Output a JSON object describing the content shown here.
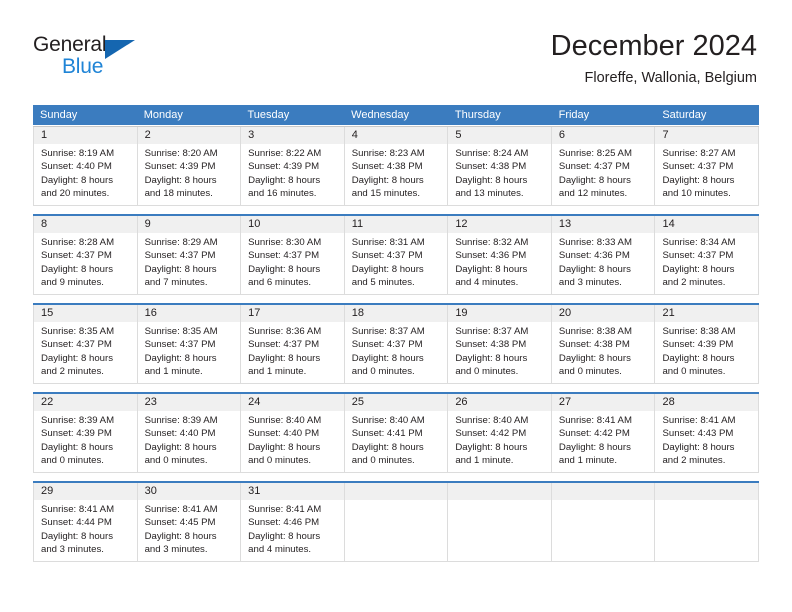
{
  "brand": {
    "name_part1": "General",
    "name_part2": "Blue",
    "accent_color": "#1f84d6",
    "triangle_color": "#1566b0"
  },
  "header": {
    "title": "December 2024",
    "subtitle": "Floreffe, Wallonia, Belgium"
  },
  "calendar": {
    "header_bg": "#3b7cbf",
    "weekdays": [
      "Sunday",
      "Monday",
      "Tuesday",
      "Wednesday",
      "Thursday",
      "Friday",
      "Saturday"
    ],
    "weeks": [
      [
        {
          "day": "1",
          "sunrise": "Sunrise: 8:19 AM",
          "sunset": "Sunset: 4:40 PM",
          "daylight_line1": "Daylight: 8 hours",
          "daylight_line2": "and 20 minutes."
        },
        {
          "day": "2",
          "sunrise": "Sunrise: 8:20 AM",
          "sunset": "Sunset: 4:39 PM",
          "daylight_line1": "Daylight: 8 hours",
          "daylight_line2": "and 18 minutes."
        },
        {
          "day": "3",
          "sunrise": "Sunrise: 8:22 AM",
          "sunset": "Sunset: 4:39 PM",
          "daylight_line1": "Daylight: 8 hours",
          "daylight_line2": "and 16 minutes."
        },
        {
          "day": "4",
          "sunrise": "Sunrise: 8:23 AM",
          "sunset": "Sunset: 4:38 PM",
          "daylight_line1": "Daylight: 8 hours",
          "daylight_line2": "and 15 minutes."
        },
        {
          "day": "5",
          "sunrise": "Sunrise: 8:24 AM",
          "sunset": "Sunset: 4:38 PM",
          "daylight_line1": "Daylight: 8 hours",
          "daylight_line2": "and 13 minutes."
        },
        {
          "day": "6",
          "sunrise": "Sunrise: 8:25 AM",
          "sunset": "Sunset: 4:37 PM",
          "daylight_line1": "Daylight: 8 hours",
          "daylight_line2": "and 12 minutes."
        },
        {
          "day": "7",
          "sunrise": "Sunrise: 8:27 AM",
          "sunset": "Sunset: 4:37 PM",
          "daylight_line1": "Daylight: 8 hours",
          "daylight_line2": "and 10 minutes."
        }
      ],
      [
        {
          "day": "8",
          "sunrise": "Sunrise: 8:28 AM",
          "sunset": "Sunset: 4:37 PM",
          "daylight_line1": "Daylight: 8 hours",
          "daylight_line2": "and 9 minutes."
        },
        {
          "day": "9",
          "sunrise": "Sunrise: 8:29 AM",
          "sunset": "Sunset: 4:37 PM",
          "daylight_line1": "Daylight: 8 hours",
          "daylight_line2": "and 7 minutes."
        },
        {
          "day": "10",
          "sunrise": "Sunrise: 8:30 AM",
          "sunset": "Sunset: 4:37 PM",
          "daylight_line1": "Daylight: 8 hours",
          "daylight_line2": "and 6 minutes."
        },
        {
          "day": "11",
          "sunrise": "Sunrise: 8:31 AM",
          "sunset": "Sunset: 4:37 PM",
          "daylight_line1": "Daylight: 8 hours",
          "daylight_line2": "and 5 minutes."
        },
        {
          "day": "12",
          "sunrise": "Sunrise: 8:32 AM",
          "sunset": "Sunset: 4:36 PM",
          "daylight_line1": "Daylight: 8 hours",
          "daylight_line2": "and 4 minutes."
        },
        {
          "day": "13",
          "sunrise": "Sunrise: 8:33 AM",
          "sunset": "Sunset: 4:36 PM",
          "daylight_line1": "Daylight: 8 hours",
          "daylight_line2": "and 3 minutes."
        },
        {
          "day": "14",
          "sunrise": "Sunrise: 8:34 AM",
          "sunset": "Sunset: 4:37 PM",
          "daylight_line1": "Daylight: 8 hours",
          "daylight_line2": "and 2 minutes."
        }
      ],
      [
        {
          "day": "15",
          "sunrise": "Sunrise: 8:35 AM",
          "sunset": "Sunset: 4:37 PM",
          "daylight_line1": "Daylight: 8 hours",
          "daylight_line2": "and 2 minutes."
        },
        {
          "day": "16",
          "sunrise": "Sunrise: 8:35 AM",
          "sunset": "Sunset: 4:37 PM",
          "daylight_line1": "Daylight: 8 hours",
          "daylight_line2": "and 1 minute."
        },
        {
          "day": "17",
          "sunrise": "Sunrise: 8:36 AM",
          "sunset": "Sunset: 4:37 PM",
          "daylight_line1": "Daylight: 8 hours",
          "daylight_line2": "and 1 minute."
        },
        {
          "day": "18",
          "sunrise": "Sunrise: 8:37 AM",
          "sunset": "Sunset: 4:37 PM",
          "daylight_line1": "Daylight: 8 hours",
          "daylight_line2": "and 0 minutes."
        },
        {
          "day": "19",
          "sunrise": "Sunrise: 8:37 AM",
          "sunset": "Sunset: 4:38 PM",
          "daylight_line1": "Daylight: 8 hours",
          "daylight_line2": "and 0 minutes."
        },
        {
          "day": "20",
          "sunrise": "Sunrise: 8:38 AM",
          "sunset": "Sunset: 4:38 PM",
          "daylight_line1": "Daylight: 8 hours",
          "daylight_line2": "and 0 minutes."
        },
        {
          "day": "21",
          "sunrise": "Sunrise: 8:38 AM",
          "sunset": "Sunset: 4:39 PM",
          "daylight_line1": "Daylight: 8 hours",
          "daylight_line2": "and 0 minutes."
        }
      ],
      [
        {
          "day": "22",
          "sunrise": "Sunrise: 8:39 AM",
          "sunset": "Sunset: 4:39 PM",
          "daylight_line1": "Daylight: 8 hours",
          "daylight_line2": "and 0 minutes."
        },
        {
          "day": "23",
          "sunrise": "Sunrise: 8:39 AM",
          "sunset": "Sunset: 4:40 PM",
          "daylight_line1": "Daylight: 8 hours",
          "daylight_line2": "and 0 minutes."
        },
        {
          "day": "24",
          "sunrise": "Sunrise: 8:40 AM",
          "sunset": "Sunset: 4:40 PM",
          "daylight_line1": "Daylight: 8 hours",
          "daylight_line2": "and 0 minutes."
        },
        {
          "day": "25",
          "sunrise": "Sunrise: 8:40 AM",
          "sunset": "Sunset: 4:41 PM",
          "daylight_line1": "Daylight: 8 hours",
          "daylight_line2": "and 0 minutes."
        },
        {
          "day": "26",
          "sunrise": "Sunrise: 8:40 AM",
          "sunset": "Sunset: 4:42 PM",
          "daylight_line1": "Daylight: 8 hours",
          "daylight_line2": "and 1 minute."
        },
        {
          "day": "27",
          "sunrise": "Sunrise: 8:41 AM",
          "sunset": "Sunset: 4:42 PM",
          "daylight_line1": "Daylight: 8 hours",
          "daylight_line2": "and 1 minute."
        },
        {
          "day": "28",
          "sunrise": "Sunrise: 8:41 AM",
          "sunset": "Sunset: 4:43 PM",
          "daylight_line1": "Daylight: 8 hours",
          "daylight_line2": "and 2 minutes."
        }
      ],
      [
        {
          "day": "29",
          "sunrise": "Sunrise: 8:41 AM",
          "sunset": "Sunset: 4:44 PM",
          "daylight_line1": "Daylight: 8 hours",
          "daylight_line2": "and 3 minutes."
        },
        {
          "day": "30",
          "sunrise": "Sunrise: 8:41 AM",
          "sunset": "Sunset: 4:45 PM",
          "daylight_line1": "Daylight: 8 hours",
          "daylight_line2": "and 3 minutes."
        },
        {
          "day": "31",
          "sunrise": "Sunrise: 8:41 AM",
          "sunset": "Sunset: 4:46 PM",
          "daylight_line1": "Daylight: 8 hours",
          "daylight_line2": "and 4 minutes."
        },
        {
          "day": "",
          "sunrise": "",
          "sunset": "",
          "daylight_line1": "",
          "daylight_line2": ""
        },
        {
          "day": "",
          "sunrise": "",
          "sunset": "",
          "daylight_line1": "",
          "daylight_line2": ""
        },
        {
          "day": "",
          "sunrise": "",
          "sunset": "",
          "daylight_line1": "",
          "daylight_line2": ""
        },
        {
          "day": "",
          "sunrise": "",
          "sunset": "",
          "daylight_line1": "",
          "daylight_line2": ""
        }
      ]
    ]
  }
}
